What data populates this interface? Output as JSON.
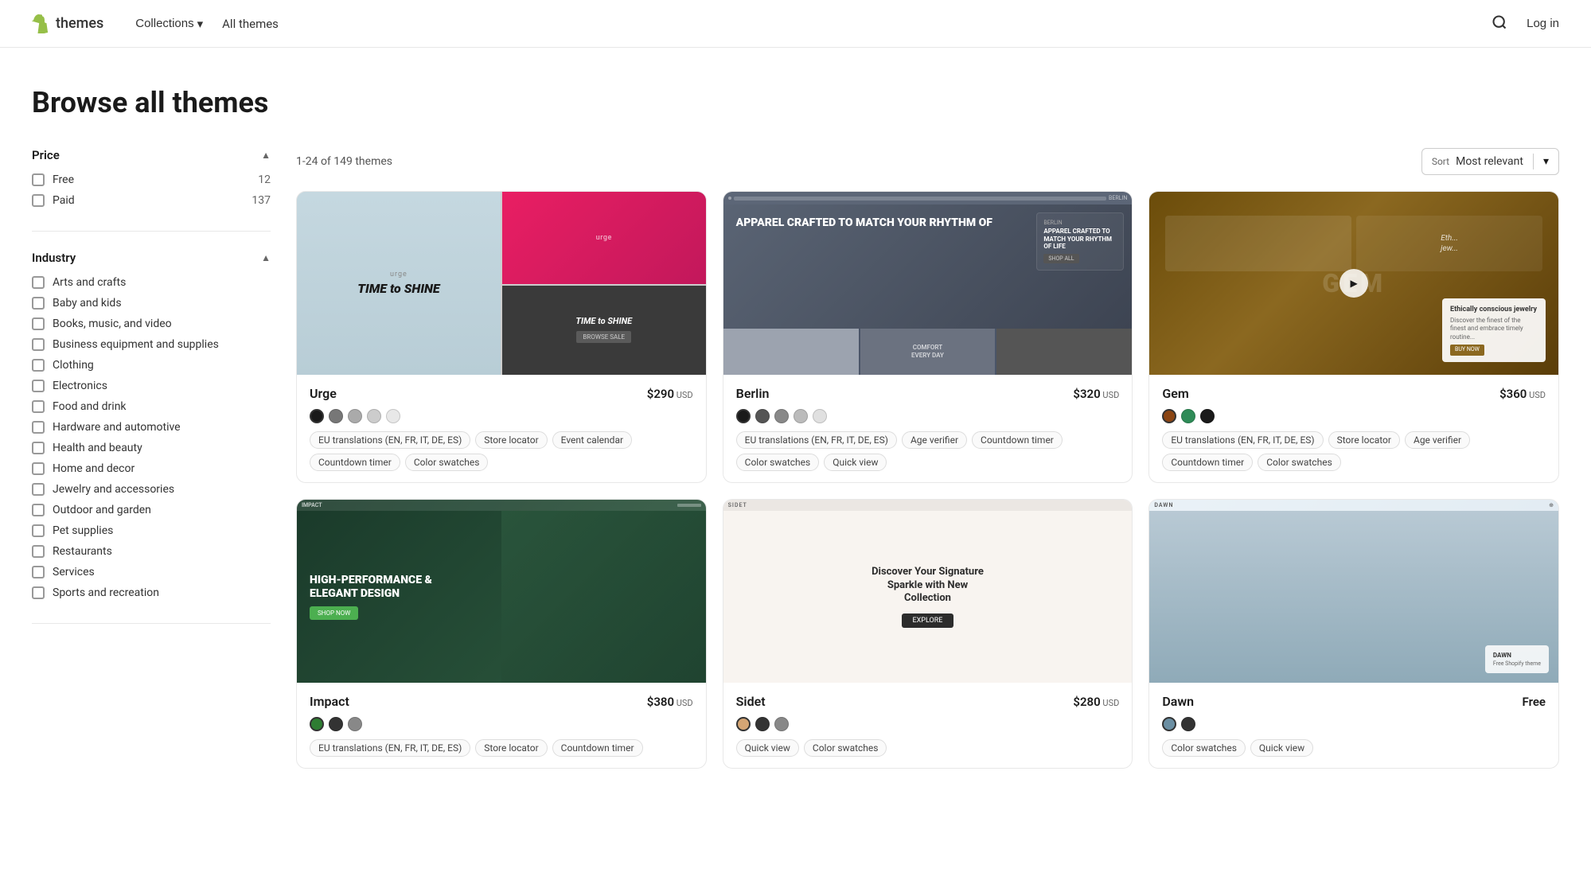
{
  "header": {
    "logo_text": "themes",
    "nav": {
      "collections_label": "Collections",
      "all_themes_label": "All themes"
    },
    "login_label": "Log in"
  },
  "hero": {
    "title": "Browse all themes"
  },
  "sidebar": {
    "price_section": {
      "title": "Price",
      "items": [
        {
          "label": "Free",
          "count": "12"
        },
        {
          "label": "Paid",
          "count": "137"
        }
      ]
    },
    "industry_section": {
      "title": "Industry",
      "items": [
        {
          "label": "Arts and crafts"
        },
        {
          "label": "Baby and kids"
        },
        {
          "label": "Books, music, and video"
        },
        {
          "label": "Business equipment and supplies"
        },
        {
          "label": "Clothing"
        },
        {
          "label": "Electronics"
        },
        {
          "label": "Food and drink"
        },
        {
          "label": "Hardware and automotive"
        },
        {
          "label": "Health and beauty"
        },
        {
          "label": "Home and decor"
        },
        {
          "label": "Jewelry and accessories"
        },
        {
          "label": "Outdoor and garden"
        },
        {
          "label": "Pet supplies"
        },
        {
          "label": "Restaurants"
        },
        {
          "label": "Services"
        },
        {
          "label": "Sports and recreation"
        }
      ]
    }
  },
  "content": {
    "results_text": "1-24 of 149 themes",
    "sort": {
      "label": "Sort",
      "value": "Most relevant"
    },
    "themes": [
      {
        "id": "urge",
        "name": "Urge",
        "price": "$290",
        "currency": "USD",
        "colors": [
          "#1a1a1a",
          "#777",
          "#aaa",
          "#ccc",
          "#e8e8e8"
        ],
        "selected_color": 0,
        "tags": [
          "EU translations (EN, FR, IT, DE, ES)",
          "Store locator",
          "Event calendar",
          "Countdown timer",
          "Color swatches"
        ],
        "preview_style": "urge"
      },
      {
        "id": "berlin",
        "name": "Berlin",
        "price": "$320",
        "currency": "USD",
        "colors": [
          "#1a1a1a",
          "#555",
          "#888",
          "#bbb",
          "#e0e0e0"
        ],
        "selected_color": 0,
        "tags": [
          "EU translations (EN, FR, IT, DE, ES)",
          "Age verifier",
          "Countdown timer",
          "Color swatches",
          "Quick view"
        ],
        "preview_style": "berlin"
      },
      {
        "id": "gem",
        "name": "Gem",
        "price": "$360",
        "currency": "USD",
        "colors": [
          "#8b4513",
          "#2e8b57",
          "#1a1a1a"
        ],
        "selected_color": 0,
        "tags": [
          "EU translations (EN, FR, IT, DE, ES)",
          "Store locator",
          "Age verifier",
          "Countdown timer",
          "Color swatches"
        ],
        "preview_style": "gem"
      },
      {
        "id": "impact",
        "name": "Impact",
        "price": "$380",
        "currency": "USD",
        "colors": [
          "#2e7d32",
          "#333",
          "#888"
        ],
        "selected_color": 0,
        "tags": [
          "EU translations (EN, FR, IT, DE, ES)",
          "Store locator",
          "Countdown timer"
        ],
        "preview_style": "impact",
        "preview_subtitle": "High-Performance & Elegant Design"
      },
      {
        "id": "sidet",
        "name": "Sidet",
        "price": "$280",
        "currency": "USD",
        "colors": [
          "#d4a574",
          "#333",
          "#888"
        ],
        "selected_color": 0,
        "tags": [
          "Quick view",
          "Color swatches"
        ],
        "preview_style": "sidet",
        "preview_subtitle": "Discover Your Signature Sparkle with New Collection"
      },
      {
        "id": "dawn",
        "name": "Dawn",
        "price": "Free",
        "currency": "",
        "colors": [
          "#6b8fa3",
          "#333"
        ],
        "selected_color": 0,
        "tags": [
          "Color swatches",
          "Quick view"
        ],
        "preview_style": "dawn"
      }
    ]
  }
}
